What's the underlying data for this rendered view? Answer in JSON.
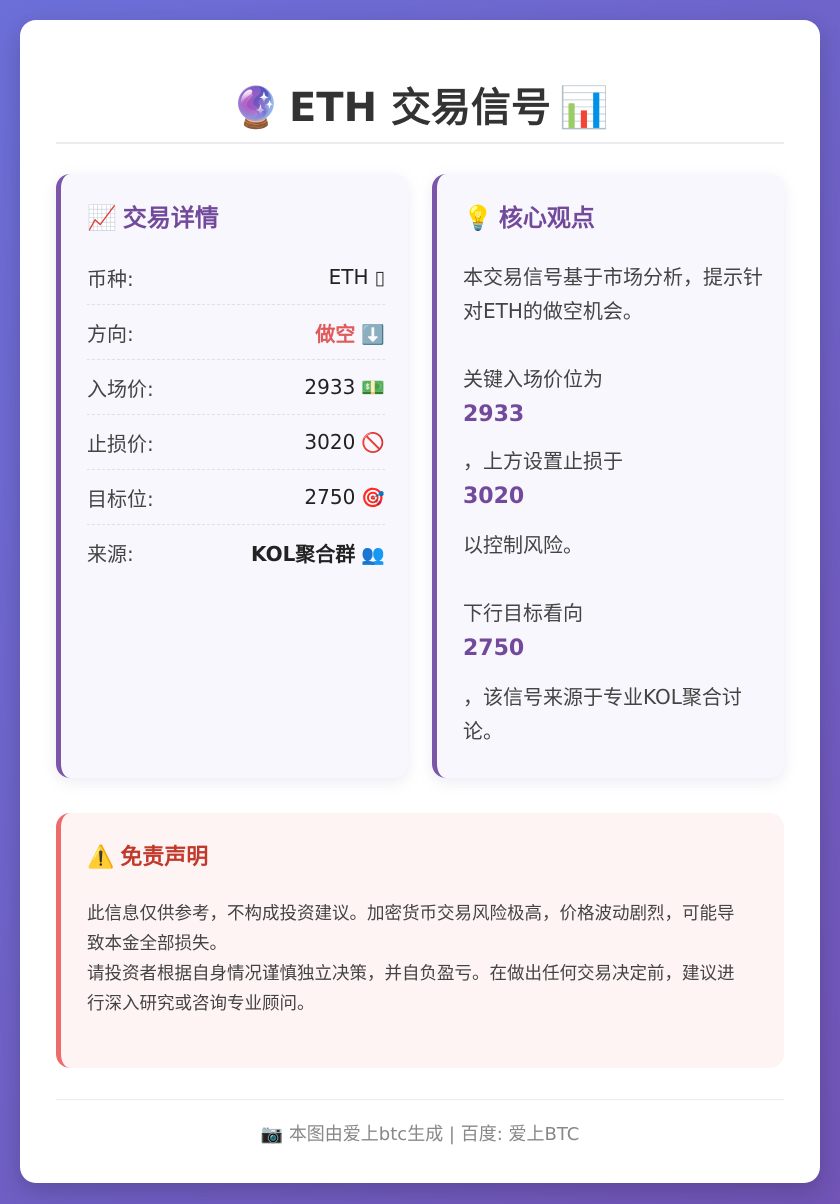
{
  "title": {
    "emoji_left": "🔮",
    "text": "ETH 交易信号",
    "emoji_right": "📊"
  },
  "details": {
    "emoji": "📈",
    "heading": "交易详情",
    "rows": [
      {
        "label": "币种:",
        "value": "ETH",
        "emoji": "▯",
        "icon": "placeholder-box-icon"
      },
      {
        "label": "方向:",
        "value": "做空",
        "emoji": "⬇️",
        "icon": "down-arrow-icon"
      },
      {
        "label": "入场价:",
        "value": "2933",
        "emoji": "💵",
        "icon": "money-icon"
      },
      {
        "label": "止损价:",
        "value": "3020",
        "emoji": "🚫",
        "icon": "prohibited-icon"
      },
      {
        "label": "目标位:",
        "value": "2750",
        "emoji": "🎯",
        "icon": "target-icon"
      },
      {
        "label": "来源:",
        "value": "KOL聚合群",
        "emoji": "👥",
        "icon": "people-icon"
      }
    ]
  },
  "view": {
    "emoji": "💡",
    "heading": "核心观点",
    "intro": "本交易信号基于市场分析，提示针对ETH的做空机会。",
    "entry_text": "关键入场价位为",
    "entry_value": "2933",
    "stop_text": "，上方设置止损于",
    "stop_value": "3020",
    "risk_text": "以控制风险。",
    "target_text": "下行目标看向",
    "target_value": "2750",
    "source_text": "，该信号来源于专业KOL聚合讨论。"
  },
  "disclaimer": {
    "emoji": "⚠️",
    "heading": "免责声明",
    "line1": "此信息仅供参考，不构成投资建议。加密货币交易风险极高，价格波动剧烈，可能导致本金全部损失。",
    "line2": "请投资者根据自身情况谨慎独立决策，并自负盈亏。在做出任何交易决定前，建议进行深入研究或咨询专业顾问。"
  },
  "footer": {
    "emoji": "📷",
    "text": "本图由爱上btc生成 | 百度: 爱上BTC"
  },
  "colors": {
    "accent": "#734a9b",
    "short": "#e05a5a",
    "warning": "#c0392b"
  }
}
